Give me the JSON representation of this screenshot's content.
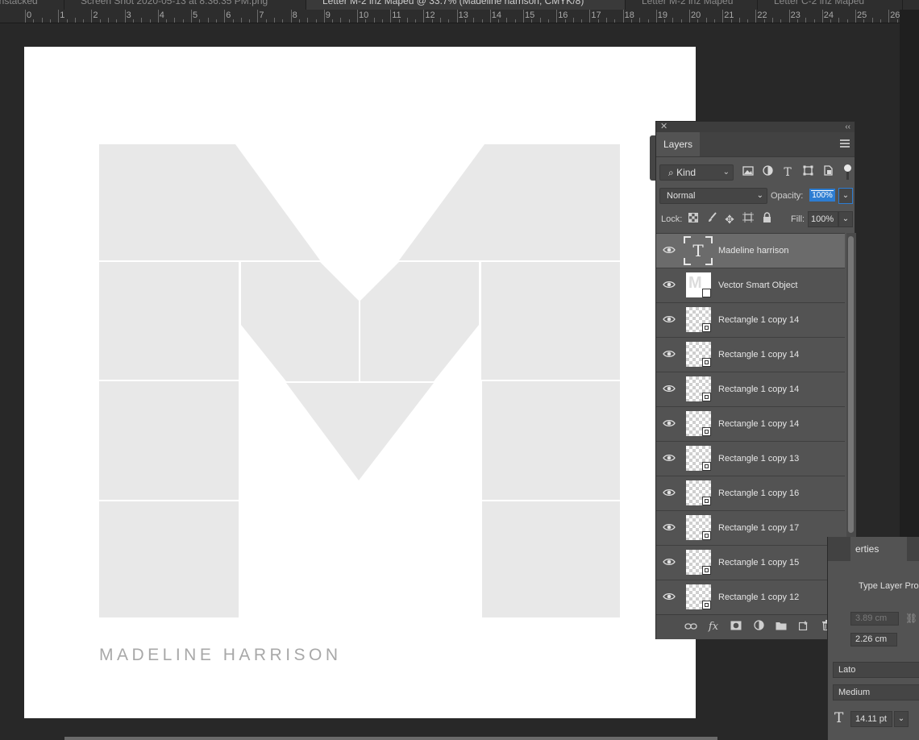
{
  "tabs": [
    {
      "label": "Unstacked"
    },
    {
      "label": "Screen Shot 2020-05-13 at 8.36.35 PM.png"
    },
    {
      "label": "Letter M-2 inz Mapeu @ 33.7% (Madeline harrison, CMYK/8)"
    },
    {
      "label": "Letter M-2 inz Mapeu"
    },
    {
      "label": "Letter C-2 inz Mapeu"
    }
  ],
  "ruler": {
    "numbers": [
      "0",
      "1",
      "2",
      "3",
      "4",
      "5",
      "6",
      "7",
      "8",
      "9",
      "10",
      "11",
      "12",
      "13",
      "14",
      "15",
      "16",
      "17",
      "18",
      "19",
      "20",
      "21",
      "22",
      "23",
      "24",
      "25",
      "26"
    ]
  },
  "canvas": {
    "brand_text": "MADELINE HARRISON"
  },
  "layers_panel": {
    "tab": "Layers",
    "filter_kind": "Kind",
    "blend_mode": "Normal",
    "opacity_label": "Opacity:",
    "opacity_value": "100%",
    "lock_label": "Lock:",
    "fill_label": "Fill:",
    "fill_value": "100%",
    "layers": [
      {
        "name": "Madeline harrison",
        "kind": "text",
        "selected": true
      },
      {
        "name": "Vector Smart Object",
        "kind": "smart"
      },
      {
        "name": "Rectangle 1 copy 14",
        "kind": "shape"
      },
      {
        "name": "Rectangle 1 copy 14",
        "kind": "shape"
      },
      {
        "name": "Rectangle 1 copy 14",
        "kind": "shape"
      },
      {
        "name": "Rectangle 1 copy 14",
        "kind": "shape"
      },
      {
        "name": "Rectangle 1 copy 13",
        "kind": "shape"
      },
      {
        "name": "Rectangle 1 copy 16",
        "kind": "shape"
      },
      {
        "name": "Rectangle 1 copy 17",
        "kind": "shape"
      },
      {
        "name": "Rectangle 1 copy 15",
        "kind": "shape"
      },
      {
        "name": "Rectangle 1 copy 12",
        "kind": "shape"
      }
    ]
  },
  "properties_panel": {
    "tab": "erties",
    "title": "Type Layer Pro",
    "width_value": "3.89 cm",
    "height_value": "2.26 cm",
    "font_family": "Lato",
    "font_style": "Medium",
    "font_size": "14.11 pt"
  },
  "icons": {
    "visibility": "eye-icon",
    "search": "search-icon",
    "link": "link-icon",
    "fx": "fx-icon",
    "mask": "mask-icon",
    "adjustment": "adjustment-icon",
    "group": "folder-icon",
    "new_layer": "new-layer-icon",
    "delete": "trash-icon"
  }
}
